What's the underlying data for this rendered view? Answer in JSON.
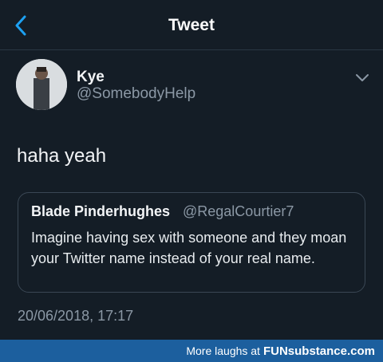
{
  "header": {
    "title": "Tweet",
    "back_icon": "chevron-left-icon"
  },
  "tweet": {
    "display_name": "Kye",
    "handle": "@SomebodyHelp",
    "text": "haha yeah",
    "timestamp": "20/06/2018, 17:17",
    "menu_icon": "chevron-down-icon"
  },
  "quoted_tweet": {
    "display_name": "Blade Pinderhughes",
    "handle": "@RegalCourtier7",
    "text": "Imagine having sex with someone and they moan your Twitter name instead of your real name."
  },
  "footer": {
    "prefix": "More laughs at",
    "brand": "FUNsubstance.com"
  },
  "colors": {
    "background": "#141d26",
    "accent": "#1da1f2",
    "secondary_text": "#8b98a5",
    "footer_bar": "#1c5f9e"
  }
}
